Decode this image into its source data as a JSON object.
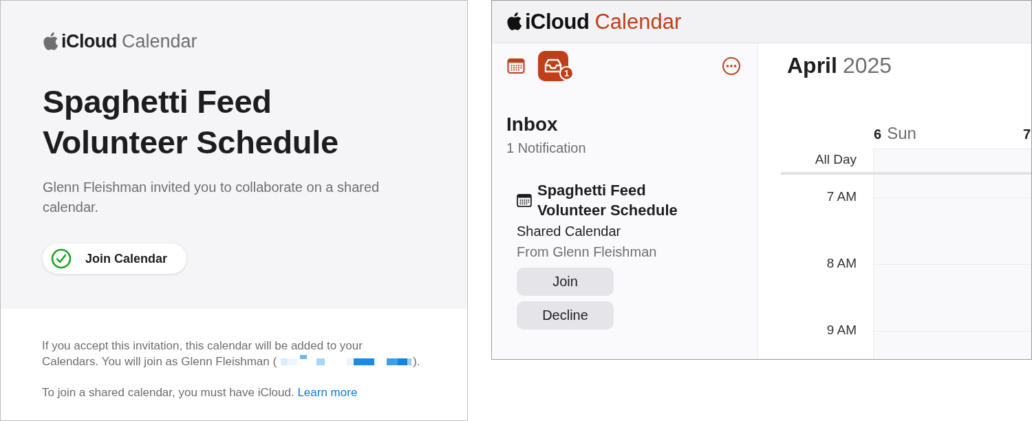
{
  "invitation": {
    "logo": {
      "brand": "iCloud",
      "product": "Calendar"
    },
    "title": "Spaghetti Feed Volunteer Schedule",
    "message": "Glenn Fleishman invited you to collaborate on a shared calendar.",
    "join_button": "Join Calendar",
    "notice": {
      "line1": "If you accept this invitation, this calendar will be added to your",
      "before": "Calendars. You will join as Glenn Fleishman (",
      "after": ")."
    },
    "footer": "To join a shared calendar, you must have iCloud.",
    "link": "Learn more"
  },
  "app": {
    "header": {
      "brand": "iCloud",
      "product": "Calendar"
    },
    "toolbar": [
      {
        "kind": "calendar",
        "selected": false
      },
      {
        "kind": "inbox",
        "selected": true,
        "badge": "1"
      }
    ],
    "inbox": {
      "heading": "Inbox",
      "subtitle": "1 Notification",
      "notifications": [
        {
          "title": "Spaghetti Feed Volunteer Schedule",
          "type": "Shared Calendar",
          "from": "From Glenn Fleishman",
          "actions": [
            "Join",
            "Decline"
          ]
        }
      ]
    },
    "calendar": {
      "month": "April",
      "year": "2025",
      "days": [
        {
          "number": "6",
          "weekday": "Sun"
        },
        {
          "number": "7"
        }
      ],
      "all_day": "All Day",
      "hours": [
        "7 AM",
        "8 AM",
        "9 AM"
      ]
    }
  }
}
